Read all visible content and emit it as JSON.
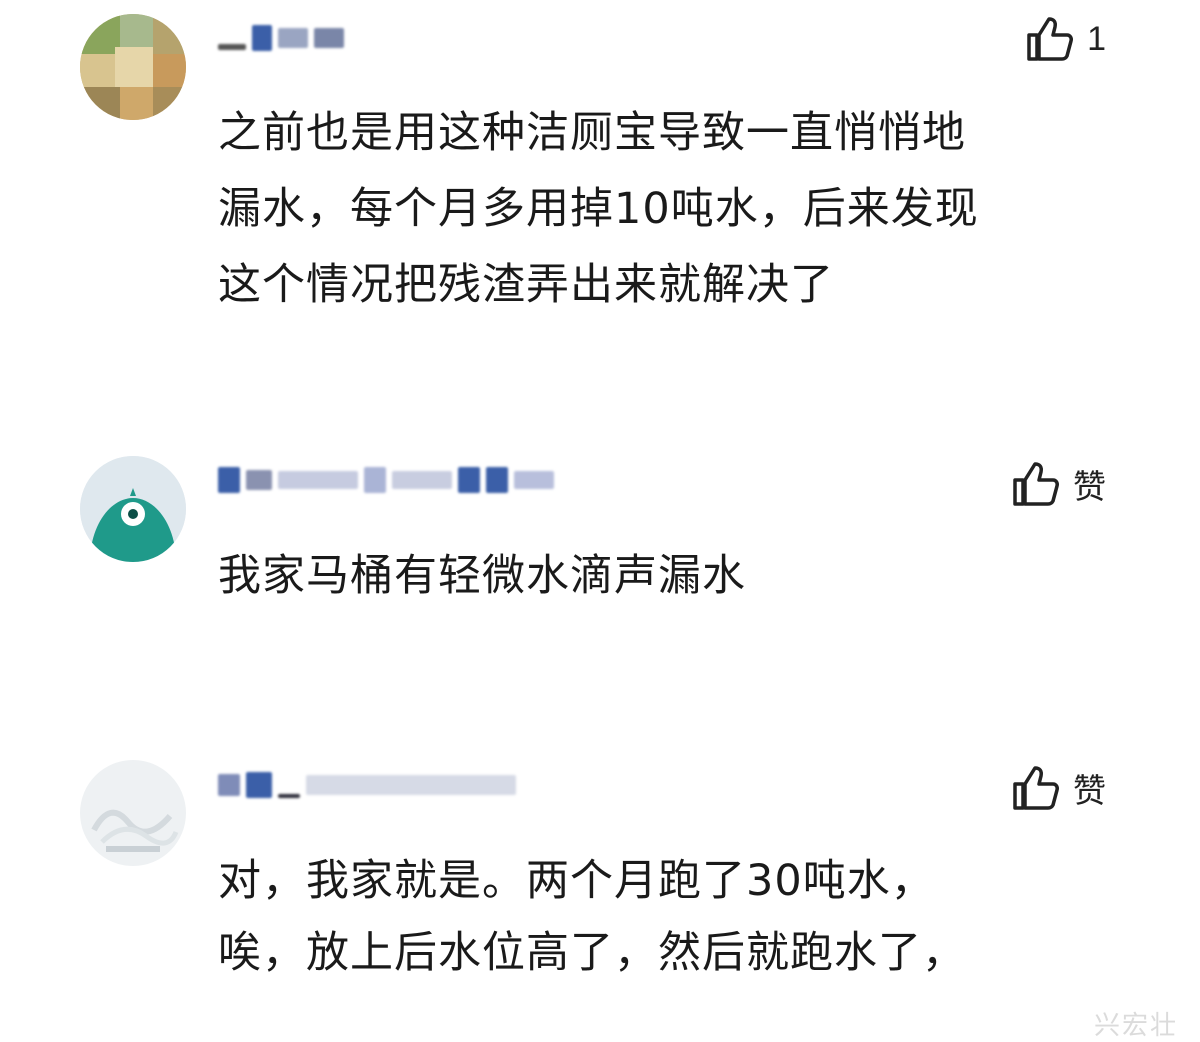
{
  "comments": [
    {
      "username_masked": "…",
      "like_count": "1",
      "lines": [
        "之前也是用这种洁厕宝导致一直悄悄地",
        "漏水，每个月多用掉10吨水，后来发现",
        "这个情况把残渣弄出来就解决了"
      ]
    },
    {
      "username_masked": "…",
      "like_label": "赞",
      "lines": [
        "我家马桶有轻微水滴声漏水"
      ]
    },
    {
      "username_masked": "…",
      "like_label": "赞",
      "lines": [
        "对，我家就是。两个月跑了30吨水，",
        "唉，放上后水位高了，然后就跑水了，"
      ]
    }
  ],
  "colors": {
    "text": "#1a1a1a",
    "blur_blue": "#3b5fa8",
    "avatar_teal": "#1f9a8a"
  },
  "icons": [
    "thumbs-up-icon",
    "avatar-placeholder-icon"
  ],
  "watermark_text": "兴宏壮"
}
